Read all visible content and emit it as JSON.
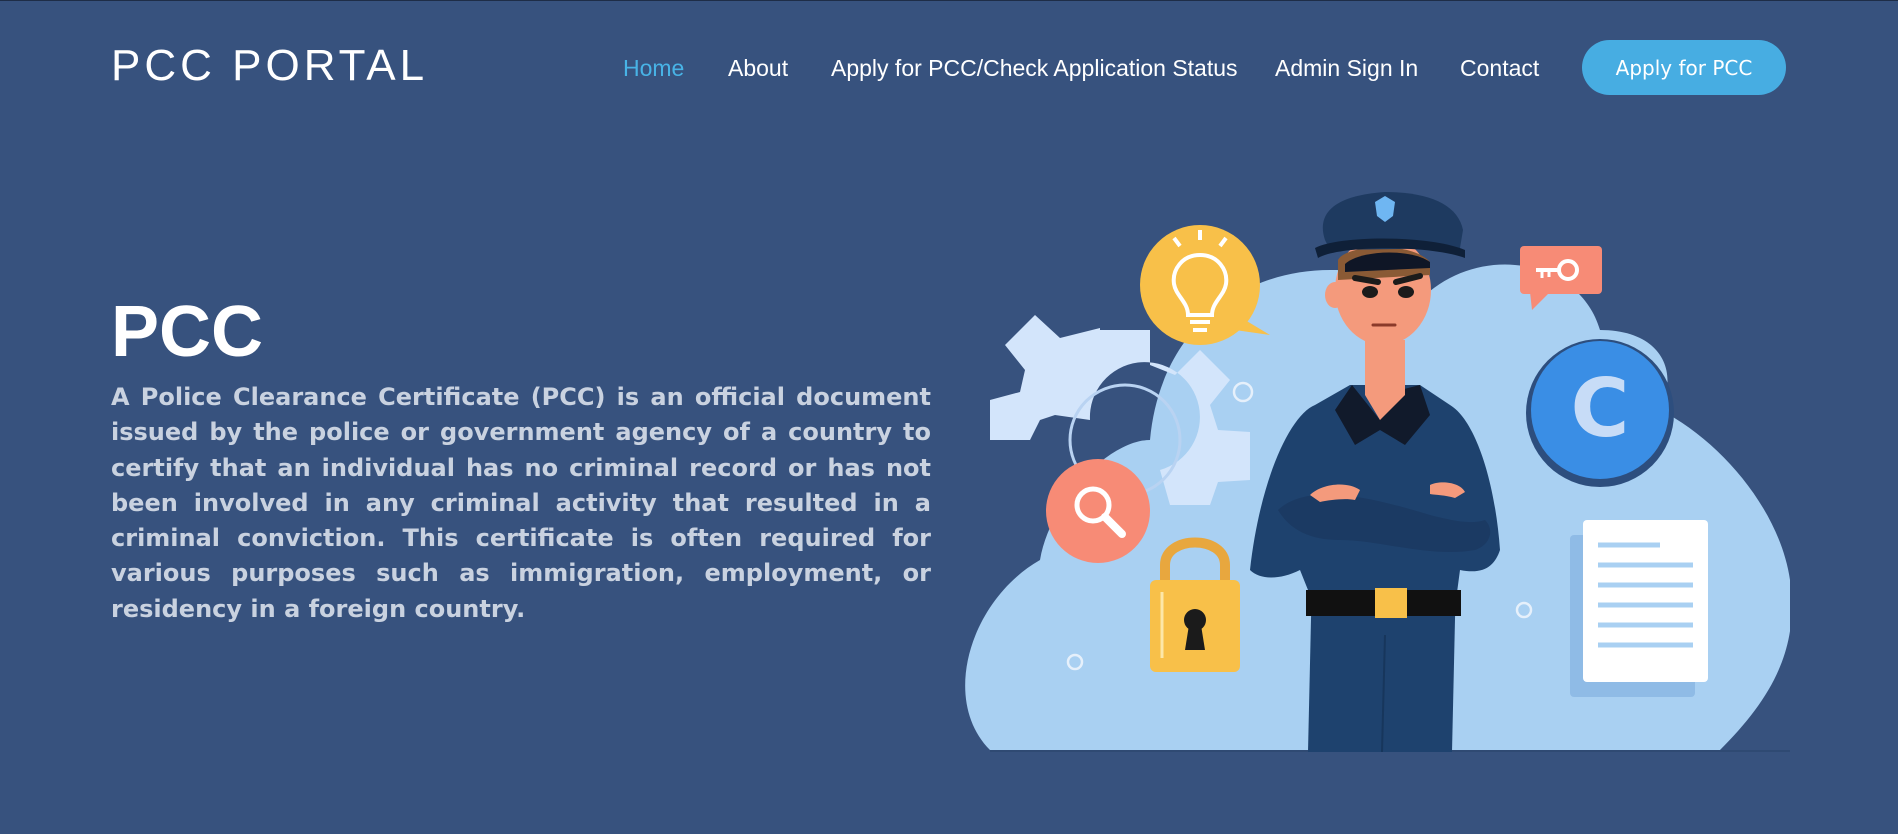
{
  "header": {
    "logo": "PCC PORTAL",
    "nav": [
      {
        "label": "Home",
        "active": true
      },
      {
        "label": "About",
        "active": false
      },
      {
        "label": "Apply for PCC/Check Application Status",
        "active": false
      },
      {
        "label": "Admin Sign In",
        "active": false
      },
      {
        "label": "Contact",
        "active": false
      }
    ],
    "cta_label": "Apply for PCC"
  },
  "hero": {
    "title": "PCC",
    "description": "A Police Clearance Certificate (PCC) is an official document issued by the police or government agency of a country to certify that an individual has no criminal record or has not been involved in any criminal activity that resulted in a criminal conviction. This certificate is often required for various purposes such as immigration, employment, or residency in a foreign country.",
    "illustration_icons": [
      "police-officer",
      "lightbulb-icon",
      "gear-icon",
      "search-icon",
      "lock-icon",
      "key-icon",
      "copyright-icon",
      "document-icon"
    ],
    "illustration_letter": "C"
  },
  "colors": {
    "background": "#37527e",
    "accent": "#48b3e6",
    "button": "#47ade2",
    "cloud": "#a9d0f2",
    "uniform": "#1e426e"
  }
}
